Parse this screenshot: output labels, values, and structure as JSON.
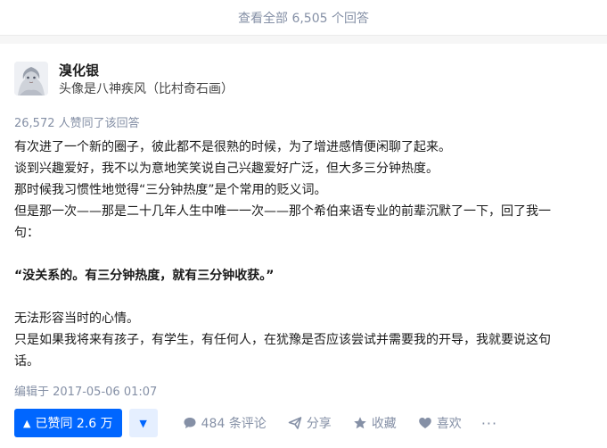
{
  "view_all": {
    "label": "查看全部 6,505 个回答"
  },
  "author": {
    "name": "溴化银",
    "bio": "头像是八神疾风（比村奇石画）"
  },
  "votes_summary": "26,572 人赞同了该回答",
  "content": {
    "lines": [
      "有次进了一个新的圈子，彼此都不是很熟的时候，为了增进感情便闲聊了起来。",
      "谈到兴趣爱好，我不以为意地笑笑说自己兴趣爱好广泛，但大多三分钟热度。",
      "那时候我习惯性地觉得“三分钟热度”是个常用的贬义词。",
      "但是那一次——那是二十几年人生中唯一一次——那个希伯来语专业的前辈沉默了一下，回了我一",
      "句：",
      "“没关系的。有三分钟热度，就有三分钟收获。”",
      "无法形容当时的心情。",
      "只是如果我将来有孩子，有学生，有任何人，在犹豫是否应该尝试并需要我的开导，我就要说这句",
      "话。"
    ]
  },
  "edit_time": "编辑于 2017-05-06 01:07",
  "actions": {
    "vote_up_label": "已赞同 2.6 万",
    "comments_label": "484 条评论",
    "share_label": "分享",
    "favorite_label": "收藏",
    "like_label": "喜欢",
    "more_label": "···"
  },
  "colors": {
    "accent": "#0066ff",
    "muted": "#8590a6"
  },
  "icons": {
    "vote_up": "triangle-up-icon",
    "vote_down": "triangle-down-icon",
    "comment": "comment-bubble-icon",
    "share": "paper-plane-icon",
    "favorite": "star-icon",
    "like": "heart-icon"
  }
}
